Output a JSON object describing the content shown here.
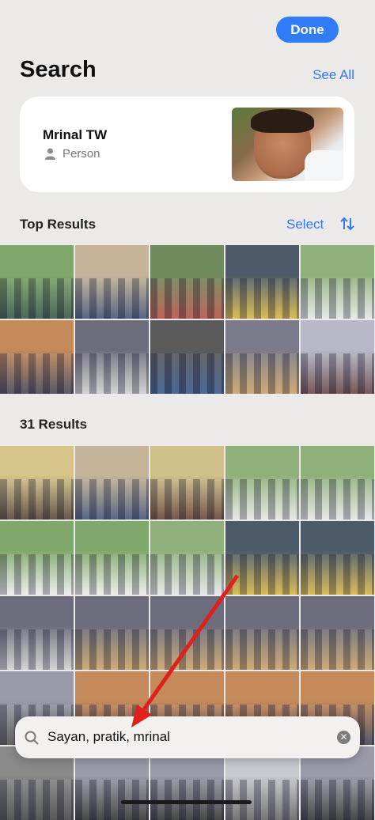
{
  "header": {
    "done_label": "Done",
    "title": "Search",
    "see_all_label": "See All"
  },
  "person_card": {
    "name": "Mrinal TW",
    "type": "Person",
    "icon": "person-icon"
  },
  "top_results": {
    "label": "Top Results",
    "select_label": "Select",
    "sort_icon": "sort-arrows-icon",
    "photos": [
      {
        "colors": [
          "#7fa86a",
          "#3d5a4a"
        ]
      },
      {
        "colors": [
          "#c6b49a",
          "#4a5a7a"
        ]
      },
      {
        "colors": [
          "#6e8a5a",
          "#b8574a"
        ]
      },
      {
        "colors": [
          "#4c5a6a",
          "#d6b74a"
        ]
      },
      {
        "colors": [
          "#8fb07a",
          "#e6e6e6"
        ]
      },
      {
        "colors": [
          "#c58a5a",
          "#4a4a5a"
        ]
      },
      {
        "colors": [
          "#6c6c7c",
          "#d0d0d0"
        ]
      },
      {
        "colors": [
          "#5a5a5a",
          "#3b5a8a"
        ]
      },
      {
        "colors": [
          "#7a7a8a",
          "#c8a46a"
        ]
      },
      {
        "colors": [
          "#b8b8c8",
          "#6a4a4a"
        ]
      }
    ]
  },
  "all_results": {
    "label": "31 Results",
    "photos": [
      {
        "colors": [
          "#d6c48a",
          "#5a4a3a"
        ]
      },
      {
        "colors": [
          "#c6b49a",
          "#4a5a7a"
        ]
      },
      {
        "colors": [
          "#d0c08a",
          "#6a4a3a"
        ]
      },
      {
        "colors": [
          "#8fb07a",
          "#e6e6e6"
        ]
      },
      {
        "colors": [
          "#8fb07a",
          "#e6e6e6"
        ]
      },
      {
        "colors": [
          "#7fa86a",
          "#ececec"
        ]
      },
      {
        "colors": [
          "#7fa86a",
          "#ececec"
        ]
      },
      {
        "colors": [
          "#8fb07a",
          "#e6e6e6"
        ]
      },
      {
        "colors": [
          "#4c5a6a",
          "#d6b74a"
        ]
      },
      {
        "colors": [
          "#4c5a6a",
          "#d6b74a"
        ]
      },
      {
        "colors": [
          "#6c6c7c",
          "#d0d0d0"
        ]
      },
      {
        "colors": [
          "#6c6c7c",
          "#c8a46a"
        ]
      },
      {
        "colors": [
          "#6c6c7c",
          "#c8a46a"
        ]
      },
      {
        "colors": [
          "#6c6c7c",
          "#c8a46a"
        ]
      },
      {
        "colors": [
          "#6c6c7c",
          "#c8a46a"
        ]
      },
      {
        "colors": [
          "#9a9aa8",
          "#5a5a5a"
        ]
      },
      {
        "colors": [
          "#c58a5a",
          "#4a4a5a"
        ]
      },
      {
        "colors": [
          "#c58a5a",
          "#4a4a5a"
        ]
      },
      {
        "colors": [
          "#c58a5a",
          "#4a4a5a"
        ]
      },
      {
        "colors": [
          "#c58a5a",
          "#4a4a5a"
        ]
      },
      {
        "colors": [
          "#8a8a8a",
          "#4a4a4a"
        ]
      },
      {
        "colors": [
          "#9a9aa8",
          "#3a3a3a"
        ]
      },
      {
        "colors": [
          "#9a9aa8",
          "#3a3a3a"
        ]
      },
      {
        "colors": [
          "#c8c8d0",
          "#6a6a6a"
        ]
      },
      {
        "colors": [
          "#9a9aa8",
          "#3a3a3a"
        ]
      }
    ]
  },
  "search": {
    "icon": "search-icon",
    "query": "Sayan, pratik, mrinal",
    "clear_icon": "clear-icon"
  },
  "annotation": {
    "color": "#e0201c"
  }
}
